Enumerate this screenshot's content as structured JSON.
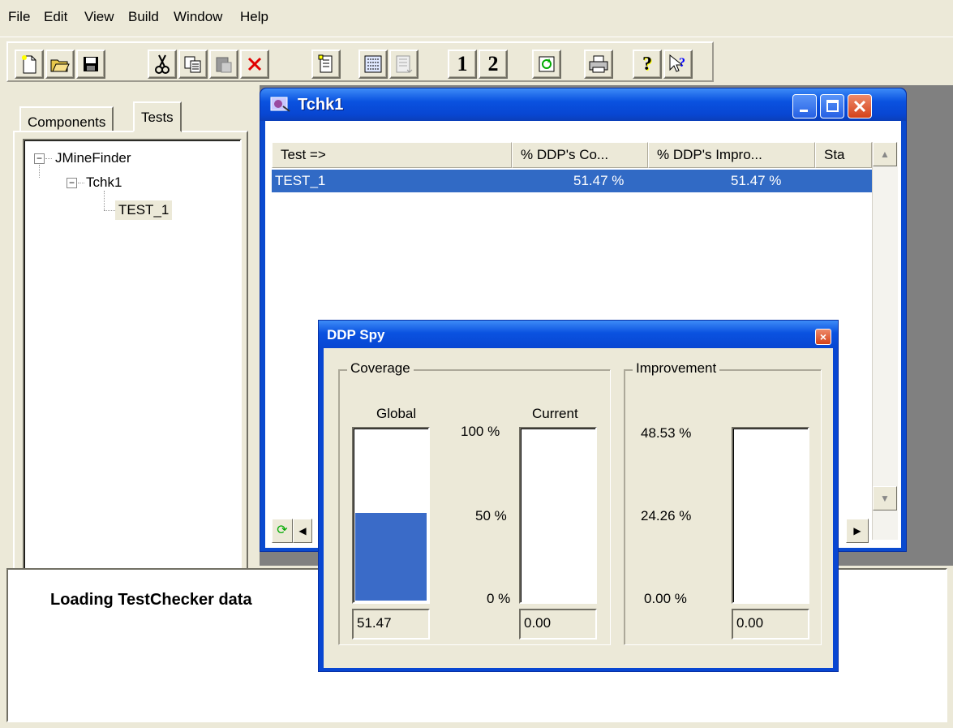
{
  "menu": [
    "File",
    "Edit",
    "View",
    "Build",
    "Window",
    "Help"
  ],
  "toolbar": {
    "buttons": [
      "new-icon",
      "open-folder-icon",
      "save-icon",
      "cut-icon",
      "copy-icon",
      "paste-icon",
      "delete-icon",
      "properties-icon",
      "run-all-icon",
      "run-icon",
      "mode-1",
      "mode-2",
      "refresh-icon",
      "print-icon",
      "help-icon",
      "context-help-icon"
    ],
    "mode1_label": "1",
    "mode2_label": "2"
  },
  "tabs": {
    "components": "Components",
    "tests": "Tests"
  },
  "tree": {
    "root": "JMineFinder",
    "child": "Tchk1",
    "leaf": "TEST_1"
  },
  "tchk_window": {
    "title": "Tchk1",
    "columns": [
      "Test  =>",
      "% DDP's Co...",
      "% DDP's Impro...",
      "Sta"
    ],
    "row": {
      "test": "TEST_1",
      "coverage": "51.47 %",
      "improvement": "51.47 %"
    }
  },
  "output": {
    "text": "Loading TestChecker data"
  },
  "spy": {
    "title": "DDP Spy",
    "coverage": {
      "label": "Coverage",
      "global_label": "Global",
      "current_label": "Current",
      "ticks": [
        "100 %",
        "50 %",
        "0 %"
      ],
      "global_value": "51.47",
      "current_value": "0.00",
      "global_fraction": 0.5147,
      "current_fraction": 0
    },
    "improvement": {
      "label": "Improvement",
      "ticks": [
        "48.53 %",
        "24.26 %",
        "0.00 %"
      ],
      "value": "0.00",
      "fraction": 0
    }
  },
  "colors": {
    "title_blue": "#0A52E0",
    "selection": "#316AC5",
    "meter_fill": "#3A6BC8"
  }
}
